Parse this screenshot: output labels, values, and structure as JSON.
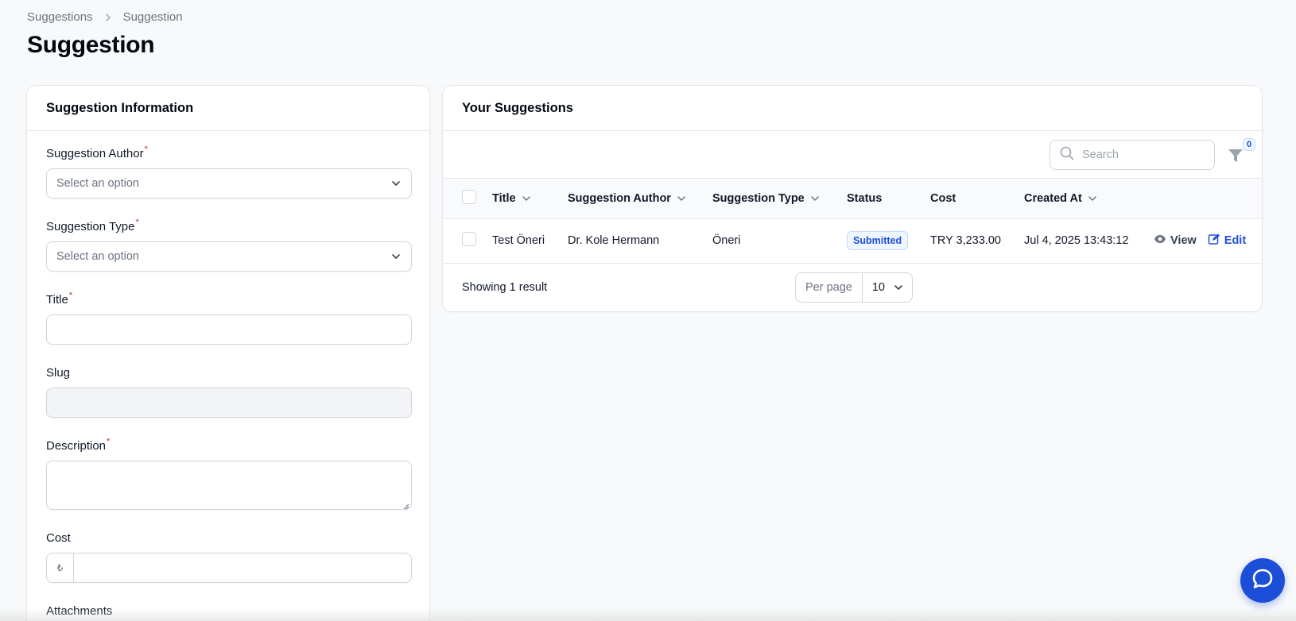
{
  "breadcrumb": {
    "items": [
      "Suggestions",
      "Suggestion"
    ]
  },
  "page": {
    "title": "Suggestion"
  },
  "form": {
    "header": "Suggestion Information",
    "fields": {
      "author": {
        "label": "Suggestion Author",
        "placeholder": "Select an option"
      },
      "type": {
        "label": "Suggestion Type",
        "placeholder": "Select an option"
      },
      "title": {
        "label": "Title",
        "value": ""
      },
      "slug": {
        "label": "Slug",
        "value": ""
      },
      "description": {
        "label": "Description",
        "value": ""
      },
      "cost": {
        "label": "Cost",
        "prefix": "₺",
        "value": ""
      },
      "attachments": {
        "label": "Attachments"
      }
    },
    "required_mark": "*"
  },
  "table_card": {
    "header": "Your Suggestions",
    "search_placeholder": "Search",
    "filter_count": "0",
    "columns": [
      "Title",
      "Suggestion Author",
      "Suggestion Type",
      "Status",
      "Cost",
      "Created At"
    ],
    "rows": [
      {
        "title": "Test Öneri",
        "author": "Dr. Kole Hermann",
        "type": "Öneri",
        "status": "Submitted",
        "cost": "TRY 3,233.00",
        "created_at": "Jul 4, 2025 13:43:12",
        "view_label": "View",
        "edit_label": "Edit"
      }
    ],
    "footer": {
      "summary": "Showing 1 result",
      "per_page_label": "Per page",
      "per_page_value": "10"
    }
  },
  "colors": {
    "accent": "#1d4ed8",
    "required": "#dc2626",
    "background": "#f8f9fa"
  },
  "icons": [
    "chevron-right-icon",
    "chevron-down-icon",
    "search-icon",
    "filter-icon",
    "eye-icon",
    "edit-icon",
    "chat-icon"
  ]
}
